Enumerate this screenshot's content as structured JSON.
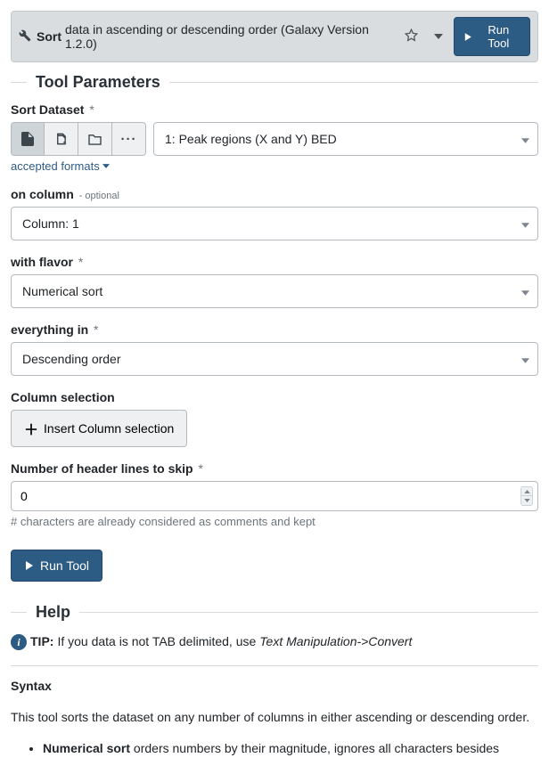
{
  "header": {
    "tool_name": "Sort",
    "description": "data in ascending or descending order (Galaxy Version 1.2.0)",
    "run_label": "Run Tool"
  },
  "sections": {
    "params_title": "Tool Parameters",
    "help_title": "Help"
  },
  "fields": {
    "sort_dataset": {
      "label": "Sort Dataset",
      "req": "*",
      "value": "1: Peak regions (X and Y) BED",
      "accepted": "accepted formats"
    },
    "on_column": {
      "label": "on column",
      "optional": "- optional",
      "value": "Column: 1"
    },
    "with_flavor": {
      "label": "with flavor",
      "req": "*",
      "value": "Numerical sort"
    },
    "everything_in": {
      "label": "everything in",
      "req": "*",
      "value": "Descending order"
    },
    "column_selection": {
      "label": "Column selection",
      "insert": "Insert Column selection"
    },
    "header_lines": {
      "label": "Number of header lines to skip",
      "req": "*",
      "value": "0",
      "hint": "# characters are already considered as comments and kept"
    }
  },
  "run_button": "Run Tool",
  "help": {
    "tip_label": "TIP:",
    "tip_text": "If you data is not TAB delimited, use ",
    "tip_italic": "Text Manipulation->Convert",
    "syntax_h": "Syntax",
    "syntax_p": "This tool sorts the dataset on any number of columns in either ascending or descending order.",
    "li1_b": "Numerical sort",
    "li1_t": " orders numbers by their magnitude, ignores all characters besides"
  }
}
